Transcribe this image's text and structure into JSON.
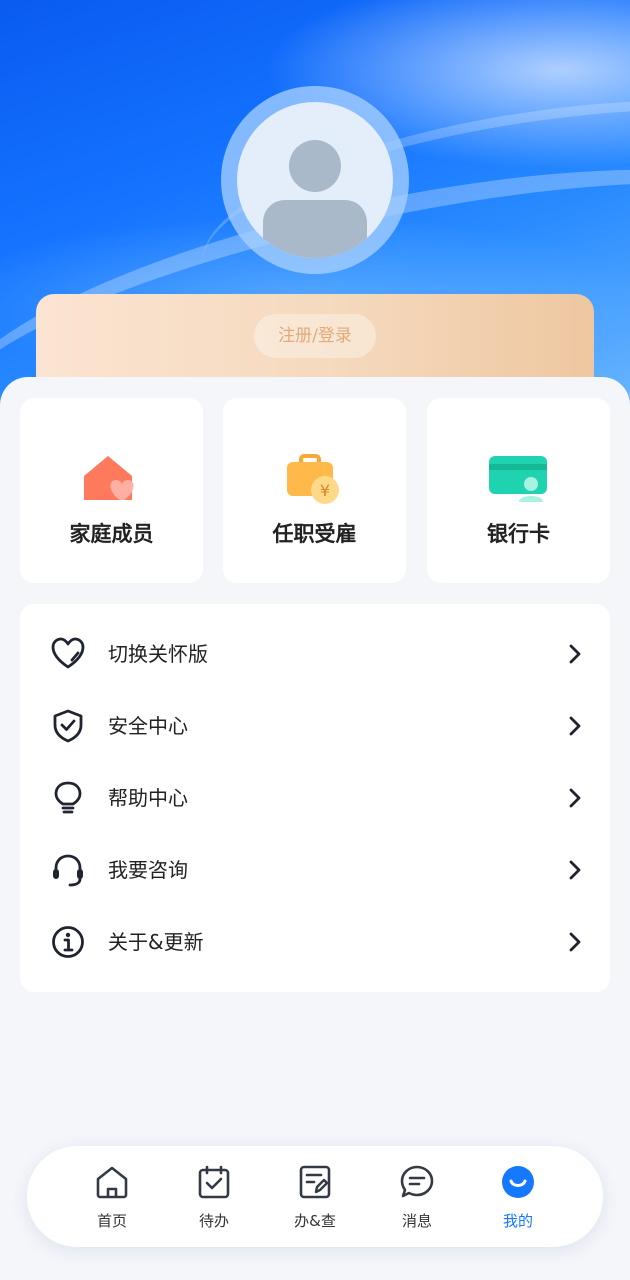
{
  "profile": {
    "avatar_icon": "default-user-avatar",
    "login_label": "注册/登录"
  },
  "quick_actions": [
    {
      "label": "家庭成员",
      "icon": "house-heart-icon",
      "color": "#ff6b57"
    },
    {
      "label": "任职受雇",
      "icon": "briefcase-yen-icon",
      "color": "#ffb23f"
    },
    {
      "label": "银行卡",
      "icon": "bank-card-icon",
      "color": "#1fd3b0"
    }
  ],
  "menu": [
    {
      "label": "切换关怀版",
      "icon": "heart-icon"
    },
    {
      "label": "安全中心",
      "icon": "shield-check-icon"
    },
    {
      "label": "帮助中心",
      "icon": "lightbulb-icon"
    },
    {
      "label": "我要咨询",
      "icon": "headset-icon"
    },
    {
      "label": "关于&更新",
      "icon": "info-icon"
    }
  ],
  "tabbar": {
    "active": "我的",
    "accent_color": "#1677ff",
    "tabs": [
      {
        "label": "首页",
        "icon": "home-icon"
      },
      {
        "label": "待办",
        "icon": "calendar-check-icon"
      },
      {
        "label": "办&查",
        "icon": "form-edit-icon"
      },
      {
        "label": "消息",
        "icon": "message-icon"
      },
      {
        "label": "我的",
        "icon": "smile-icon"
      }
    ]
  }
}
